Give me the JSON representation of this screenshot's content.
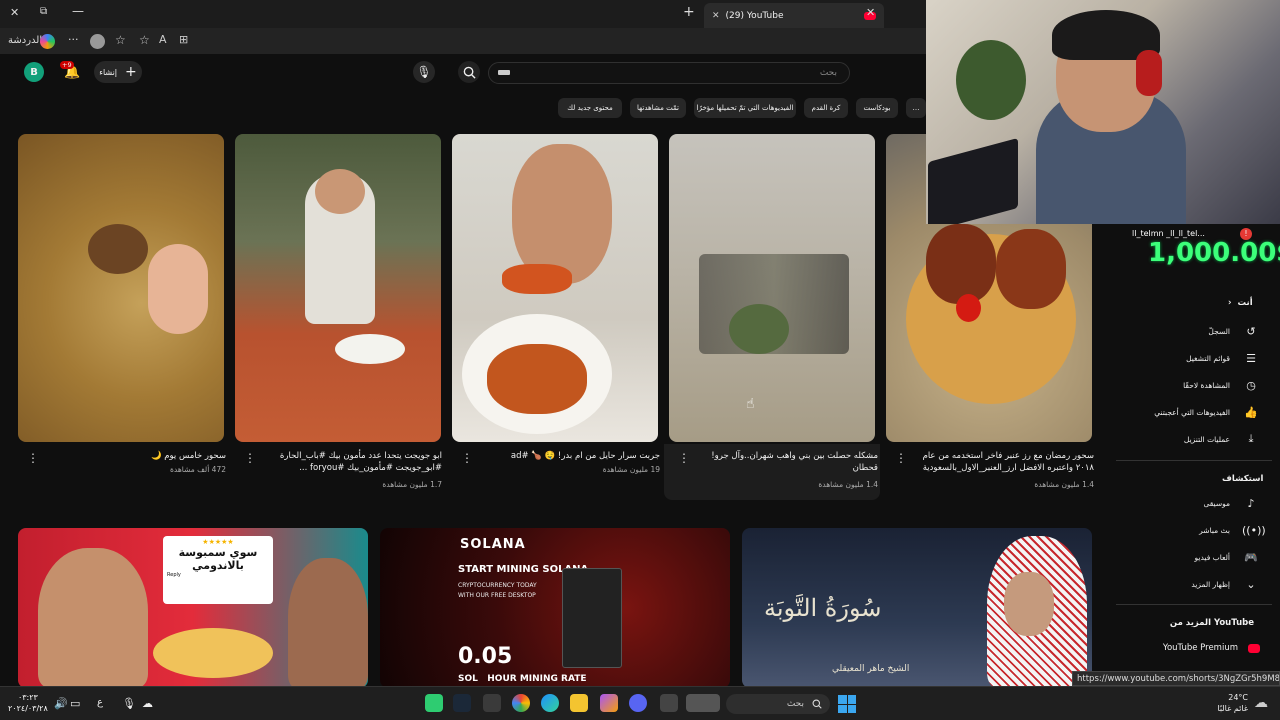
{
  "browser": {
    "tab_title": "(29) YouTube",
    "profile_label": "الدردشة"
  },
  "youtube": {
    "avatar_letter": "B",
    "notifications_badge": "+9",
    "create_label": "إنشاء",
    "search_placeholder": "بحث",
    "chips": [
      "بودكاست",
      "كرة القدم",
      "الفيديوهات التي تمّ تحميلها مؤخرًا",
      "تمّت مشاهدتها",
      "محتوى جديد لك"
    ],
    "videos": [
      {
        "title": "سحور خامس يوم 🌙",
        "views": "472 ألف مشاهدة"
      },
      {
        "title": "ابو جويجت يتحدا عدد مأمون بيك #باب_الحارة #ابو_جويجت #مأمون_بيك #foryou ...",
        "views": "1.7 مليون مشاهدة"
      },
      {
        "title": "جربت سرار حايل من ام بدر! 🤤 🍗 #ad",
        "views": "19 مليون مشاهدة"
      },
      {
        "title": "مشكله حصلت بين بني واهب شهران..وآل جرو! قحطان",
        "views": "1.4 مليون مشاهدة"
      },
      {
        "title": "سحور رمضان مع رز عنبر فاخر استخدمه من عام ٢٠١٨ واعتبره الافضل ارز_العنبر_الاول_بالسعودية",
        "views": "1.4 مليون مشاهدة"
      }
    ],
    "bottom_cards": [
      {
        "overlay_line1": "سوي سمبوسة",
        "overlay_line2": "بالاندومي",
        "reply": "Reply"
      },
      {
        "brand": "SOLANA",
        "headline": "START MINING SOLANA",
        "sub1": "CRYPTOCURRENCY TODAY",
        "sub2": "WITH OUR FREE DESKTOP",
        "rate": "0.05",
        "rate_label": "SOL   HOUR MINING RATE"
      },
      {
        "calligraphy": "سُورَةُ التَّوبَة",
        "reciter": "الشيخ ماهر المعيقلي"
      }
    ]
  },
  "sidebar": {
    "you_label": "أنت",
    "you_items": [
      {
        "label": "السجلّ",
        "icon": "history-icon"
      },
      {
        "label": "قوائم التشغيل",
        "icon": "playlist-icon"
      },
      {
        "label": "المشاهدة لاحقًا",
        "icon": "clock-icon"
      },
      {
        "label": "الفيديوهات التي أعجبتني",
        "icon": "thumb-up-icon"
      },
      {
        "label": "عمليات التنزيل",
        "icon": "download-icon"
      }
    ],
    "explore_label": "استكشاف",
    "explore_items": [
      {
        "label": "موسيقى",
        "icon": "music-icon"
      },
      {
        "label": "بث مباشر",
        "icon": "live-icon"
      },
      {
        "label": "ألعاب فيديو",
        "icon": "gaming-icon"
      },
      {
        "label": "إظهار المزيد",
        "icon": "chevron-down-icon"
      }
    ],
    "more_from": "المزيد من YouTube",
    "premium": "YouTube Premium"
  },
  "stream_overlay": {
    "user": "ll_telmn _ll_ll_tel...",
    "amount": "1,000.00$"
  },
  "status_url": "https://www.youtube.com/shorts/3NgZGr5h9M8",
  "taskbar": {
    "time": "٠٣:٢٣",
    "date": "٢٠٢٤/٠٣/٢٨",
    "weather_temp": "24°C",
    "weather_desc": "غائم غالبًا",
    "search_label": "بحث",
    "lang": "ع"
  },
  "colors": {
    "bg": "#0f0f0f",
    "chip": "#272727",
    "yt_red": "#ff0033",
    "donation_green": "#3cff7a"
  }
}
